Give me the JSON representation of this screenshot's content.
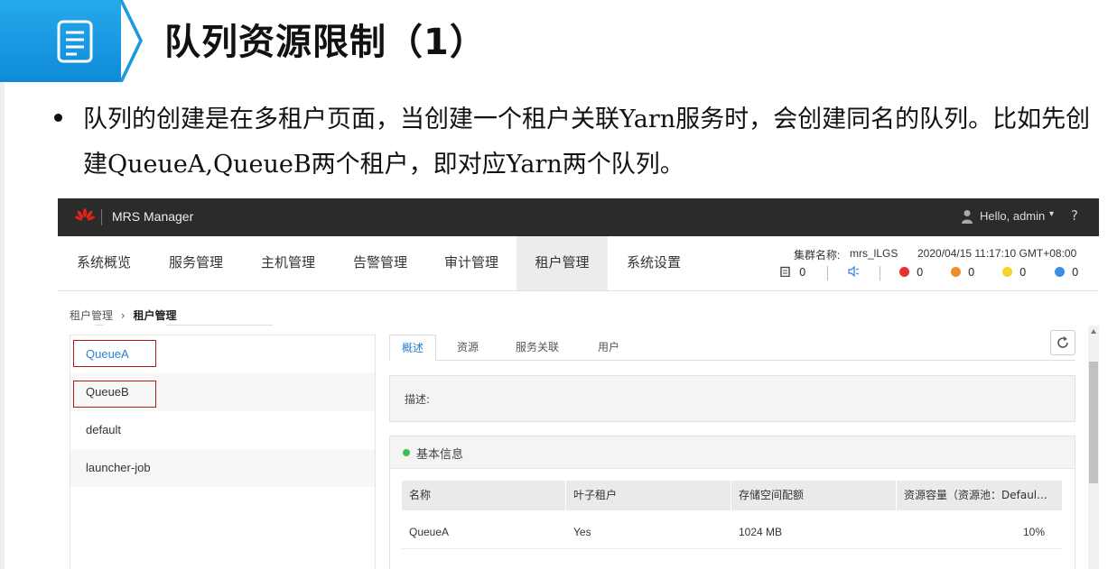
{
  "slide": {
    "title": "队列资源限制（1）",
    "paragraph": "队列的创建是在多租户页面，当创建一个租户关联Yarn服务时，会创建同名的队列。比如先创建QueueA,QueueB两个租户，即对应Yarn两个队列。"
  },
  "colors": {
    "accent_blue": "#1a9ae3",
    "topbar": "#2b2b2b",
    "highlight_red": "#b01c1c",
    "active_tab": "#2a7fd4"
  },
  "app": {
    "name": "MRS Manager",
    "user_greeting": "Hello, admin",
    "caret": "▾",
    "help": "?"
  },
  "nav": {
    "items": [
      "系统概览",
      "服务管理",
      "主机管理",
      "告警管理",
      "审计管理",
      "租户管理",
      "系统设置"
    ],
    "active": "租户管理"
  },
  "cluster": {
    "label": "集群名称:",
    "name": "mrs_lLGS",
    "datetime": "2020/04/15 11:17:10 GMT+08:00",
    "stats": {
      "tasks": "0",
      "alerts_sound": "",
      "critical": "0",
      "major": "0",
      "minor": "0",
      "info": "0"
    }
  },
  "breadcrumb": {
    "parent": "租户管理",
    "sep": "›",
    "current": "租户管理"
  },
  "tenants": [
    {
      "name": "QueueA"
    },
    {
      "name": "QueueB"
    },
    {
      "name": "default"
    },
    {
      "name": "launcher-job"
    }
  ],
  "tabs": [
    "概述",
    "资源",
    "服务关联",
    "用户"
  ],
  "description_label": "描述:",
  "basic_info": {
    "title": "基本信息",
    "headers": [
      "名称",
      "叶子租户",
      "存储空间配额",
      "资源容量（资源池：Defaul..."
    ],
    "rows": [
      [
        "QueueA",
        "Yes",
        "1024 MB",
        "10%"
      ]
    ]
  }
}
